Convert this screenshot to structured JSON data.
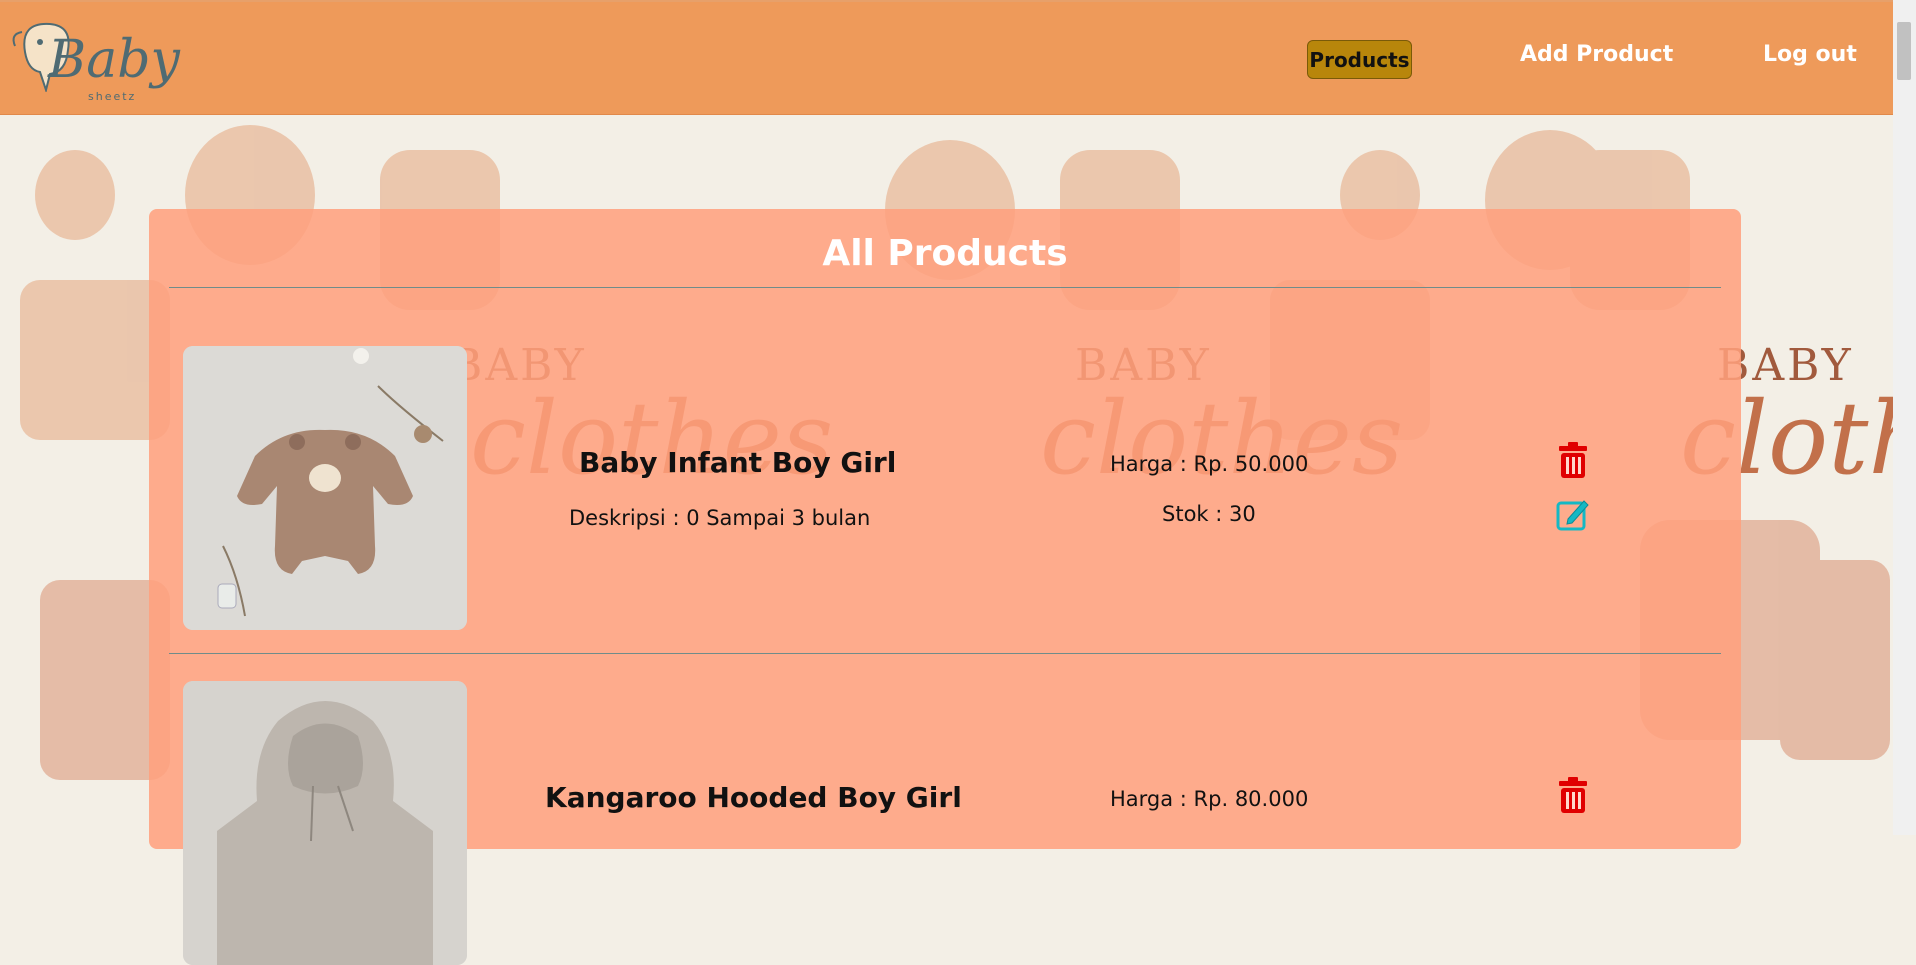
{
  "brand": {
    "logo_word": "Baby",
    "logo_sub": "sheetz"
  },
  "nav": {
    "items": [
      {
        "label": "Products",
        "active": true
      },
      {
        "label": "Add Product",
        "active": false
      },
      {
        "label": "Log out",
        "active": false
      }
    ]
  },
  "background": {
    "word1": "BABY",
    "word2": "clothes"
  },
  "panel": {
    "title": "All Products"
  },
  "products": [
    {
      "name": "Baby Infant Boy Girl",
      "description": "Deskripsi : 0 Sampai 3 bulan",
      "price": "Harga : Rp. 50.000",
      "stock": "Stok : 30"
    },
    {
      "name": "Kangaroo Hooded Boy Girl",
      "price": "Harga : Rp. 80.000"
    }
  ],
  "colors": {
    "navbar": "#ee9a5a",
    "active": "#b8860b",
    "panel": "#ffa07d",
    "delete": "#e00000",
    "edit": "#15b8c4"
  },
  "icons": {
    "delete": "trash-icon",
    "edit": "edit-icon"
  }
}
